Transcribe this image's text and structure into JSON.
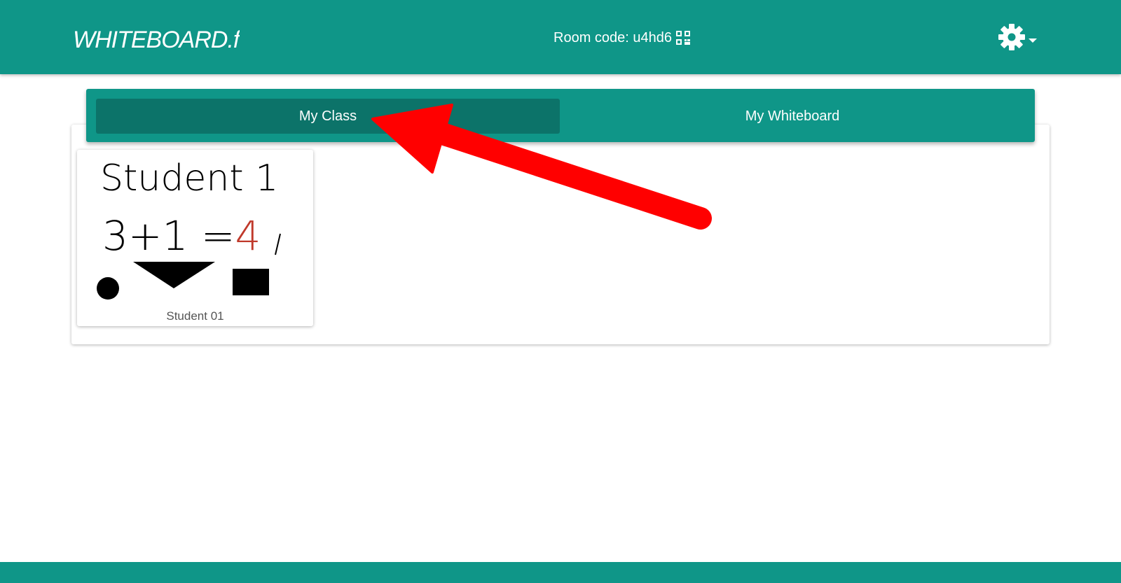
{
  "header": {
    "logo_text": "WHITEBOARD.fi",
    "room_code_label": "Room code: u4hd6"
  },
  "tabs": [
    {
      "label": "My Class",
      "active": true
    },
    {
      "label": "My Whiteboard",
      "active": false
    }
  ],
  "students": [
    {
      "name": "Student 01",
      "board_text_line1": "Student 1",
      "board_text_line2_black": "3+1 =",
      "board_text_line2_red": "4"
    }
  ],
  "colors": {
    "brand": "#0f9688",
    "tab_active": "#0c7369",
    "annotation_arrow": "#ff0000"
  },
  "icons": {
    "qr": "qr-code-icon",
    "settings": "gear-icon"
  }
}
